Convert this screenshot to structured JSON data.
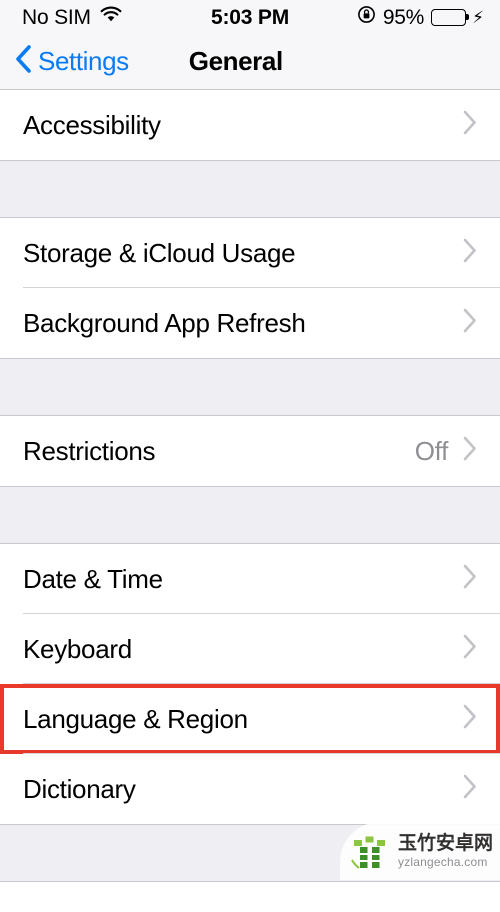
{
  "status_bar": {
    "carrier": "No SIM",
    "wifi_icon": "wifi-icon",
    "time": "5:03 PM",
    "rotation_lock_icon": "rotation-lock-icon",
    "battery_percent": "95%",
    "battery_level": 95,
    "charging_icon": "lightning-bolt-icon",
    "battery_color": "#4cd964"
  },
  "nav_bar": {
    "back_icon": "chevron-left-icon",
    "back_label": "Settings",
    "title": "General",
    "accent_color": "#0a7bf2"
  },
  "sections": [
    {
      "rows": [
        {
          "label": "Accessibility",
          "value": "",
          "chevron": "chevron-right-icon",
          "highlighted": false
        }
      ]
    },
    {
      "rows": [
        {
          "label": "Storage & iCloud Usage",
          "value": "",
          "chevron": "chevron-right-icon",
          "highlighted": false
        },
        {
          "label": "Background App Refresh",
          "value": "",
          "chevron": "chevron-right-icon",
          "highlighted": false
        }
      ]
    },
    {
      "rows": [
        {
          "label": "Restrictions",
          "value": "Off",
          "chevron": "chevron-right-icon",
          "highlighted": false
        }
      ]
    },
    {
      "rows": [
        {
          "label": "Date & Time",
          "value": "",
          "chevron": "chevron-right-icon",
          "highlighted": false
        },
        {
          "label": "Keyboard",
          "value": "",
          "chevron": "chevron-right-icon",
          "highlighted": false
        },
        {
          "label": "Language & Region",
          "value": "",
          "chevron": "chevron-right-icon",
          "highlighted": true
        },
        {
          "label": "Dictionary",
          "value": "",
          "chevron": "chevron-right-icon",
          "highlighted": false
        }
      ]
    }
  ],
  "highlight": {
    "color": "#e8392c",
    "target_label": "Language & Region"
  },
  "watermark": {
    "logo_icon": "bamboo-logo-icon",
    "site_name": "玉竹安卓网",
    "site_url": "yzlangecha.com",
    "logo_color": "#4e9b2f"
  }
}
